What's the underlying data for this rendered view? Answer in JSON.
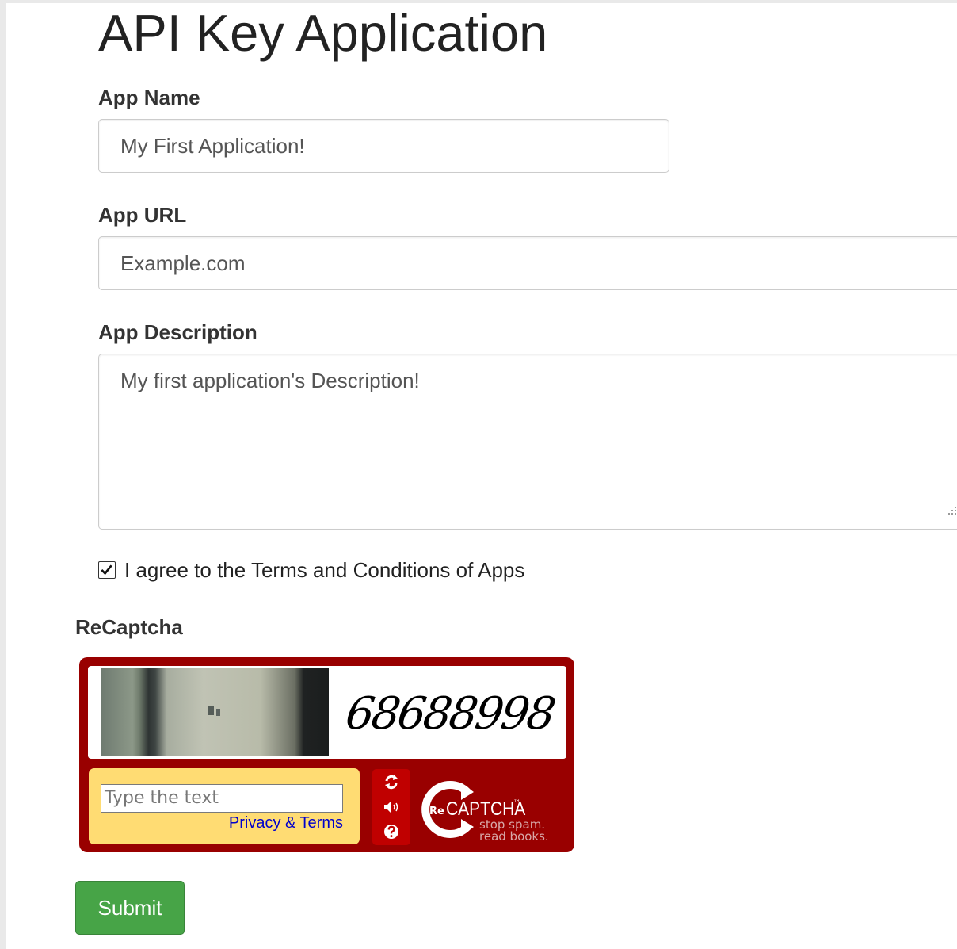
{
  "page": {
    "title": "API Key Application"
  },
  "form": {
    "app_name": {
      "label": "App Name",
      "value": "My First Application!"
    },
    "app_url": {
      "label": "App URL",
      "value": "Example.com"
    },
    "app_description": {
      "label": "App Description",
      "value": "My first application's Description!"
    },
    "terms": {
      "label": "I agree to the Terms and Conditions of Apps",
      "checked": true
    },
    "submit_label": "Submit"
  },
  "recaptcha": {
    "heading": "ReCaptcha",
    "challenge_number": "68688998",
    "input_placeholder": "Type the text",
    "privacy_link": "Privacy & Terms",
    "logo_text": "CAPTCHA",
    "logo_prefix": "Re",
    "logo_tm": "™",
    "tagline_line1": "stop spam.",
    "tagline_line2": "read books.",
    "buttons": [
      "refresh-icon",
      "audio-icon",
      "help-icon"
    ],
    "colors": {
      "frame": "#990000",
      "input_panel": "#ffdc73",
      "buttons": "#c00000"
    }
  },
  "colors": {
    "submit": "#47a447"
  }
}
